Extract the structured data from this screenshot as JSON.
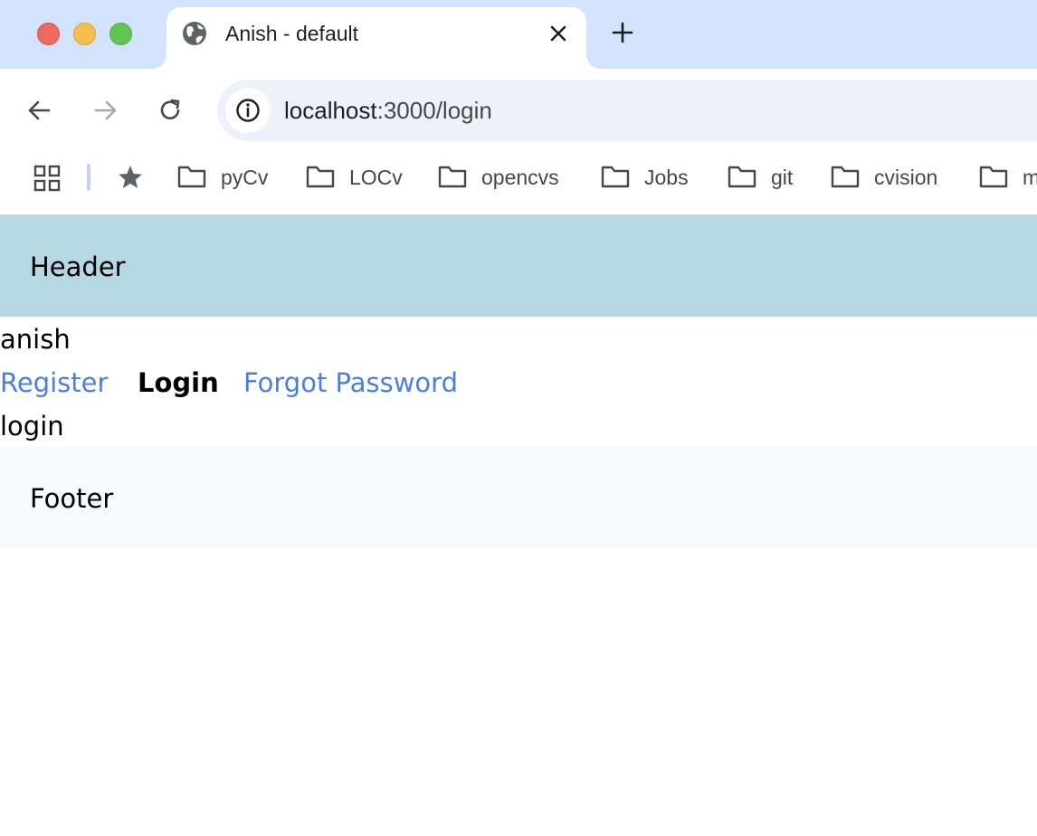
{
  "browser": {
    "tab": {
      "title": "Anish - default",
      "favicon": "globe-icon"
    },
    "address_bar": {
      "host": "localhost",
      "rest": ":3000/login"
    },
    "bookmarks": [
      {
        "label": "pyCv",
        "icon": "folder-icon"
      },
      {
        "label": "LOCv",
        "icon": "folder-icon"
      },
      {
        "label": "opencvs",
        "icon": "folder-icon"
      },
      {
        "label": "Jobs",
        "icon": "folder-icon"
      },
      {
        "label": "git",
        "icon": "folder-icon"
      },
      {
        "label": "cvision",
        "icon": "folder-icon"
      },
      {
        "label": "m",
        "icon": "folder-icon"
      }
    ],
    "colors": {
      "tabstrip": "#d3e3fd",
      "omnibox": "#edf2fa"
    }
  },
  "page": {
    "header": "Header",
    "username": "anish",
    "nav": [
      {
        "label": "Register",
        "active": false
      },
      {
        "label": "Login",
        "active": true
      },
      {
        "label": "Forgot Password",
        "active": false
      }
    ],
    "route": "login",
    "footer": "Footer",
    "colors": {
      "header_bg": "#b5d8e3",
      "footer_bg": "#f8f8ff",
      "link": "#4a7fe0"
    }
  }
}
